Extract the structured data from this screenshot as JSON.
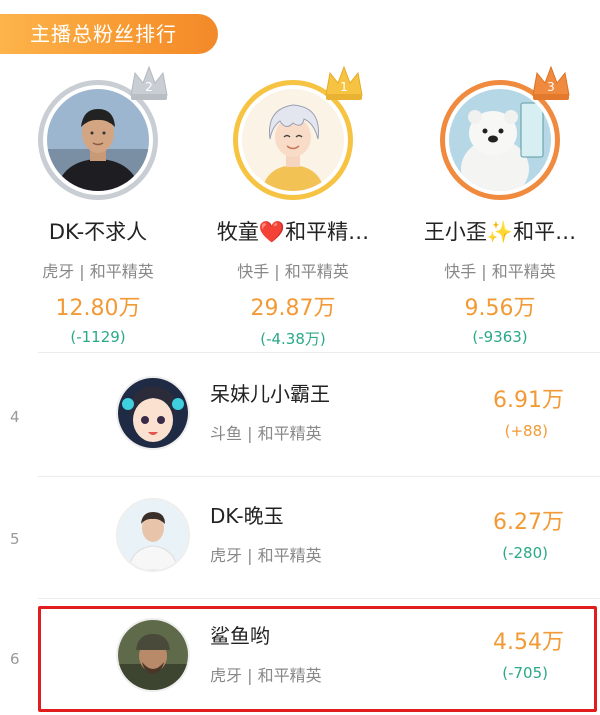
{
  "header": {
    "title": "主播总粉丝排行"
  },
  "top3": [
    {
      "rank": "2",
      "name": "DK-不求人",
      "platform": "虎牙 | 和平精英",
      "fans": "12.80万",
      "change": "(-1129)",
      "crown_color": "#c9cdd4",
      "avatar_icon": "avatar-man-dark-shirt-icon"
    },
    {
      "rank": "1",
      "name": "牧童❤️和平精…",
      "platform": "快手 | 和平精英",
      "fans": "29.87万",
      "change": "(-4.38万)",
      "crown_color": "#f6c343",
      "avatar_icon": "avatar-anime-white-hair-icon"
    },
    {
      "rank": "3",
      "name": "王小歪✨和平…",
      "platform": "快手 | 和平精英",
      "fans": "9.56万",
      "change": "(-9363)",
      "crown_color": "#f08a3e",
      "avatar_icon": "avatar-polar-bear-icon"
    }
  ],
  "list": [
    {
      "rank": "4",
      "name": "呆妹儿小霸王",
      "platform": "斗鱼 | 和平精英",
      "fans": "6.91万",
      "change": "(+88)",
      "avatar_icon": "avatar-cartoon-girl-icon"
    },
    {
      "rank": "5",
      "name": "DK-晚玉",
      "platform": "虎牙 | 和平精英",
      "fans": "6.27万",
      "change": "(-280)",
      "avatar_icon": "avatar-man-white-shirt-icon"
    },
    {
      "rank": "6",
      "name": "鲨鱼哟",
      "platform": "虎牙 | 和平精英",
      "fans": "4.54万",
      "change": "(-705)",
      "avatar_icon": "avatar-soldier-icon"
    }
  ],
  "colors": {
    "accent": "#f29a36",
    "decrease": "#2aa888",
    "highlight": "#e21d1d"
  }
}
